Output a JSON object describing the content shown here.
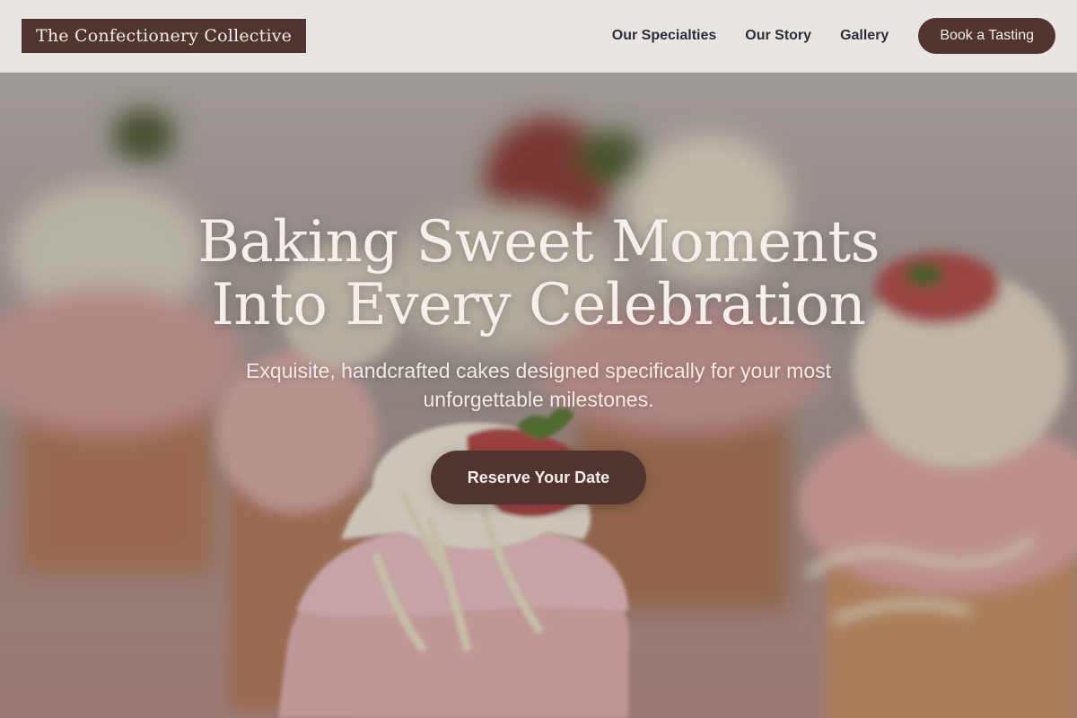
{
  "header": {
    "logo_text": "The Confectionery Collective",
    "nav": [
      {
        "label": "Our Specialties"
      },
      {
        "label": "Our Story"
      },
      {
        "label": "Gallery"
      }
    ],
    "cta_label": "Book a Tasting"
  },
  "hero": {
    "title_line1": "Baking Sweet Moments",
    "title_line2": "Into Every Celebration",
    "subtitle": "Exquisite, handcrafted cakes designed specifically for your most unforgettable milestones.",
    "button_label": "Reserve Your Date",
    "background_image": "cupcakes-photo"
  },
  "colors": {
    "brand": "#50342f",
    "header_bg": "#e9e5e3",
    "nav_text": "#2c2f3a",
    "hero_text": "#f5efec"
  }
}
